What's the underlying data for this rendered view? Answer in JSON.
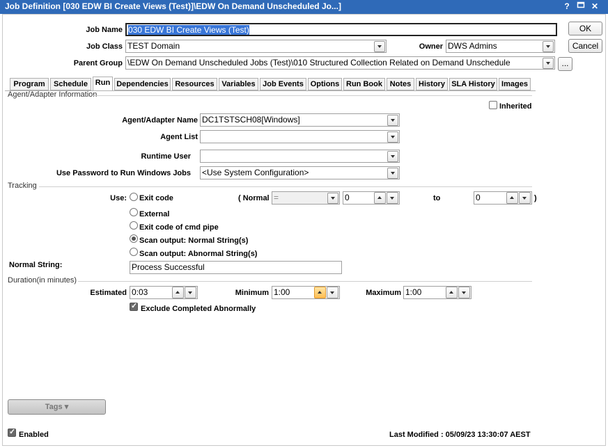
{
  "window": {
    "title": "Job Definition [030 EDW BI Create Views (Test)]\\EDW On Demand Unscheduled Jo...]",
    "help_label": "?",
    "close_label": "✕"
  },
  "header": {
    "job_name_label": "Job Name",
    "job_name_value": "030 EDW BI Create Views (Test)",
    "job_class_label": "Job Class",
    "job_class_value": "TEST Domain",
    "owner_label": "Owner",
    "owner_value": "DWS Admins",
    "parent_group_label": "Parent Group",
    "parent_group_value": "\\EDW On Demand Unscheduled Jobs (Test)\\010 Structured Collection Related on Demand Unschedule",
    "browse_label": "...",
    "ok_label": "OK",
    "cancel_label": "Cancel"
  },
  "tabs": [
    "Program",
    "Schedule",
    "Run",
    "Dependencies",
    "Resources",
    "Variables",
    "Job Events",
    "Options",
    "Run Book",
    "Notes",
    "History",
    "SLA History",
    "Images"
  ],
  "active_tab": "Run",
  "agent": {
    "section_label": "Agent/Adapter Information",
    "inherited_label": "Inherited",
    "agent_name_label": "Agent/Adapter Name",
    "agent_name_value": "DC1TSTSCH08[Windows]",
    "agent_list_label": "Agent List",
    "agent_list_value": "",
    "runtime_user_label": "Runtime User",
    "runtime_user_value": "",
    "use_password_label": "Use Password to Run Windows Jobs",
    "use_password_value": "<Use System Configuration>"
  },
  "tracking": {
    "section_label": "Tracking",
    "use_label": "Use:",
    "options": [
      "Exit code",
      "External",
      "Exit code of cmd pipe",
      "Scan output: Normal String(s)",
      "Scan output: Abnormal String(s)"
    ],
    "selected_option": "Scan output: Normal String(s)",
    "normal_label": "( Normal",
    "operator_value": "=",
    "from_value": "0",
    "to_label": "to",
    "to_value": "0",
    "close_paren": ")",
    "normal_string_label": "Normal String:",
    "normal_string_value": "Process Successful"
  },
  "duration": {
    "section_label": "Duration(in minutes)",
    "estimated_label": "Estimated",
    "estimated_value": "0:03",
    "minimum_label": "Minimum",
    "minimum_value": "1:00",
    "maximum_label": "Maximum",
    "maximum_value": "1:00",
    "exclude_label": "Exclude Completed Abnormally",
    "exclude_checked": true
  },
  "footer": {
    "tags_label": "Tags ▾",
    "enabled_label": "Enabled",
    "enabled_checked": true,
    "last_modified": "Last Modified : 05/09/23 13:30:07 AEST"
  }
}
